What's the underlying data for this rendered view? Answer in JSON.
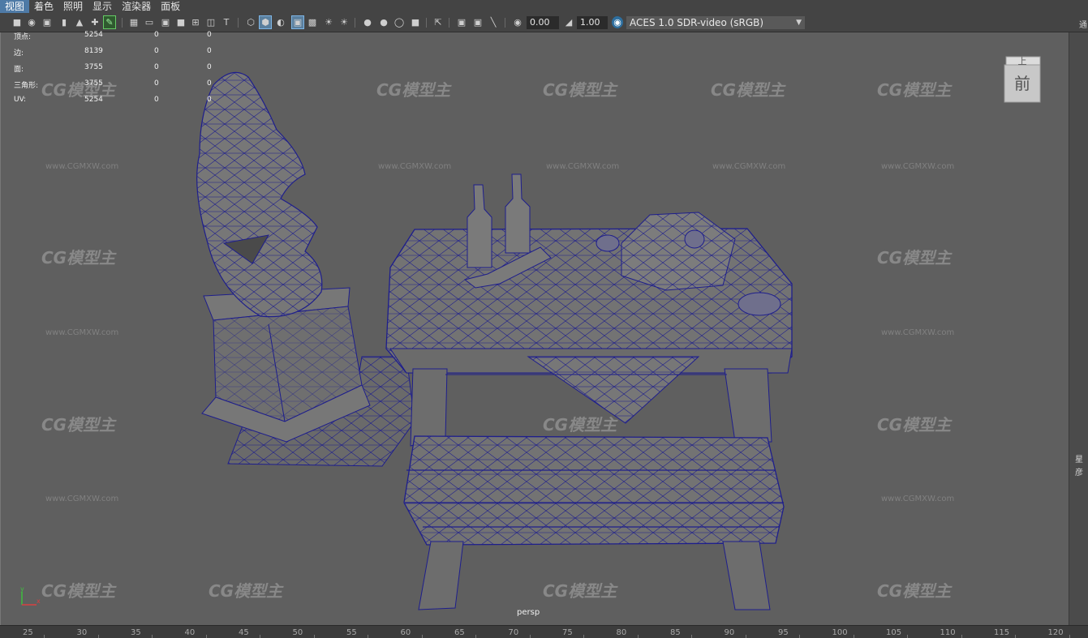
{
  "menu": {
    "items": [
      {
        "label": "视图"
      },
      {
        "label": "着色"
      },
      {
        "label": "照明"
      },
      {
        "label": "显示"
      },
      {
        "label": "渲染器"
      },
      {
        "label": "面板"
      }
    ]
  },
  "toolbar": {
    "exposure_value": "0.00",
    "gamma_value": "1.00",
    "color_space": "ACES 1.0 SDR-video (sRGB)"
  },
  "hud": {
    "rows": [
      {
        "label": "顶点:",
        "v1": "5254",
        "v2": "0",
        "v3": "0"
      },
      {
        "label": "边:",
        "v1": "8139",
        "v2": "0",
        "v3": "0"
      },
      {
        "label": "面:",
        "v1": "3755",
        "v2": "0",
        "v3": "0"
      },
      {
        "label": "三角形:",
        "v1": "3755",
        "v2": "0",
        "v3": "0"
      },
      {
        "label": "UV:",
        "v1": "5254",
        "v2": "0",
        "v3": "0"
      }
    ]
  },
  "viewcube": {
    "top_label": "上",
    "front_label": "前"
  },
  "viewport": {
    "camera_label": "persp"
  },
  "axis": {
    "y_label": "y",
    "x_label": "x",
    "y_color": "#3fbf3f",
    "x_color": "#d94040"
  },
  "right_panel": {
    "char1": "通",
    "char2": "星",
    "char3": "彦"
  },
  "timeline": {
    "ticks": [
      "25",
      "30",
      "35",
      "40",
      "45",
      "50",
      "55",
      "60",
      "65",
      "70",
      "75",
      "80",
      "85",
      "90",
      "95",
      "100",
      "105",
      "110",
      "115",
      "120"
    ]
  },
  "watermark": {
    "brand": "CG模型主",
    "url": "www.CGMXW.com"
  },
  "colors": {
    "wireframe": "#1e1e8c",
    "selection_highlight": "#4e7aa6",
    "viewport_bg": "#5f5f5f"
  }
}
